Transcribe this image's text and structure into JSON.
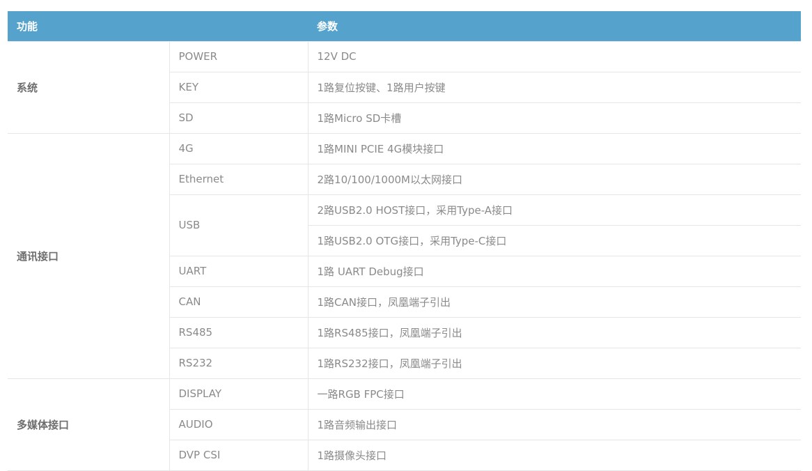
{
  "header": {
    "col1": "功能",
    "col2": "参数"
  },
  "groups": {
    "system": {
      "label": "系统",
      "rows": [
        {
          "name": "POWER",
          "value": "12V DC"
        },
        {
          "name": "KEY",
          "value": "1路复位按键、1路用户按键"
        },
        {
          "name": "SD",
          "value": "1路Micro SD卡槽"
        }
      ]
    },
    "comm": {
      "label": "通讯接口",
      "rows": [
        {
          "name": "4G",
          "value": "1路MINI PCIE 4G模块接口"
        },
        {
          "name": "Ethernet",
          "value": "2路10/100/1000M以太网接口"
        },
        {
          "name": "USB",
          "value": "2路USB2.0 HOST接口，采用Type-A接口",
          "value2": "1路USB2.0 OTG接口，采用Type-C接口"
        },
        {
          "name": "UART",
          "value": "1路 UART Debug接口"
        },
        {
          "name": "CAN",
          "value": "1路CAN接口，凤凰端子引出"
        },
        {
          "name": "RS485",
          "value": "1路RS485接口，凤凰端子引出"
        },
        {
          "name": "RS232",
          "value": "1路RS232接口，凤凰端子引出"
        }
      ]
    },
    "media": {
      "label": "多媒体接口",
      "rows": [
        {
          "name": "DISPLAY",
          "value": "一路RGB FPC接口"
        },
        {
          "name": "AUDIO",
          "value": "1路音频输出接口"
        },
        {
          "name": "DVP CSI",
          "value": "1路摄像头接口"
        }
      ]
    }
  }
}
